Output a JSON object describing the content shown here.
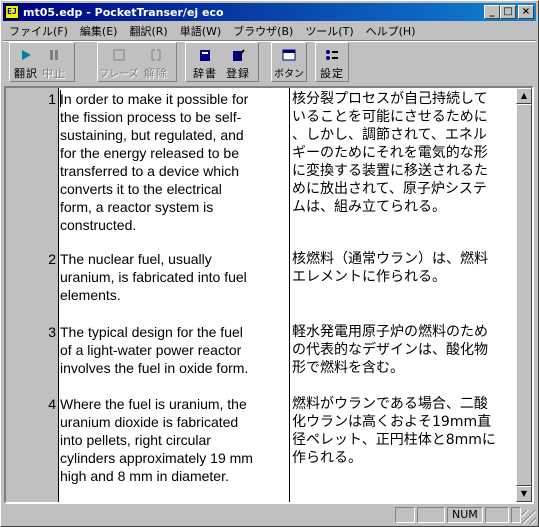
{
  "window": {
    "title": "mt05.edp - PocketTranser/ej eco",
    "icon_label": "EJ"
  },
  "menu": [
    "ファイル(F)",
    "編集(E)",
    "翻訳(R)",
    "単語(W)",
    "ブラウザ(B)",
    "ツール(T)",
    "ヘルプ(H)"
  ],
  "toolbar": {
    "translate": "翻訳",
    "stop": "中止",
    "phrase": "フレーズ",
    "release": "解除",
    "dictionary": "辞書",
    "register": "登録",
    "button": "ボタン",
    "settings": "設定"
  },
  "rows": [
    {
      "num": "1",
      "source": "In order to make it possible for\nthe fission process to be self-\nsustaining, but regulated, and\nfor the energy released to be\ntransferred to a device which\nconverts it to the electrical\nform, a reactor system is\nconstructed.",
      "target": "核分裂プロセスが自己持続して\nいることを可能にさせるために\n、しかし、調節されて、エネル\nギーのためにそれを電気的な形\nに変換する装置に移送されるた\nめに放出されて、原子炉システ\nムは、組み立てられる。"
    },
    {
      "num": "2",
      "source": "The nuclear fuel, usually\nuranium, is fabricated into fuel\nelements.",
      "target": "核燃料（通常ウラン）は、燃料\nエレメントに作られる。"
    },
    {
      "num": "3",
      "source": "The typical design for the fuel\nof a light-water power reactor\ninvolves the fuel in oxide form.",
      "target": "軽水発電用原子炉の燃料のため\nの代表的なデザインは、酸化物\n形で燃料を含む。"
    },
    {
      "num": "4",
      "source": "Where the fuel is uranium, the\nuranium dioxide is fabricated\ninto pellets,  right circular\ncylinders approximately 19 mm\nhigh and 8 mm in diameter.",
      "target": "燃料がウランである場合、二酸\n化ウランは高くおよそ19mm直\n径ペレット、正円柱体と8mmに\n作られる。"
    }
  ],
  "status": {
    "num": "NUM"
  }
}
